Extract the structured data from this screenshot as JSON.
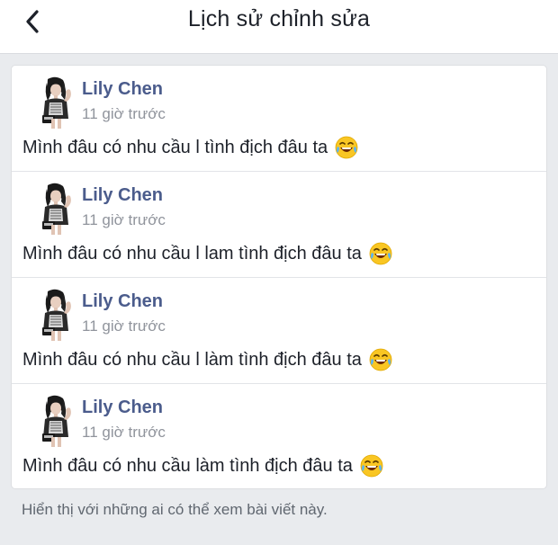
{
  "header": {
    "title": "Lịch sử chỉnh sửa",
    "back_icon": "chevron-left-icon"
  },
  "colors": {
    "author_name": "#4b5c8c",
    "timestamp": "#90949c",
    "background": "#e9ebee",
    "card": "#ffffff"
  },
  "edits": [
    {
      "author": "Lily Chen",
      "time": "11 giờ trước",
      "text": "Mình đâu có nhu cầu l tình địch đâu ta",
      "emoji": "laughing-tears-emoji-icon"
    },
    {
      "author": "Lily Chen",
      "time": "11 giờ trước",
      "text": "Mình đâu có nhu cầu l lam tình địch đâu ta",
      "emoji": "laughing-tears-emoji-icon"
    },
    {
      "author": "Lily Chen",
      "time": "11 giờ trước",
      "text": "Mình đâu có nhu cầu l làm tình địch đâu ta",
      "emoji": "laughing-tears-emoji-icon"
    },
    {
      "author": "Lily Chen",
      "time": "11 giờ trước",
      "text": "Mình đâu có nhu cầu làm tình địch đâu ta",
      "emoji": "laughing-tears-emoji-icon"
    }
  ],
  "footer": {
    "note": "Hiển thị với những ai có thể xem bài viết này."
  }
}
